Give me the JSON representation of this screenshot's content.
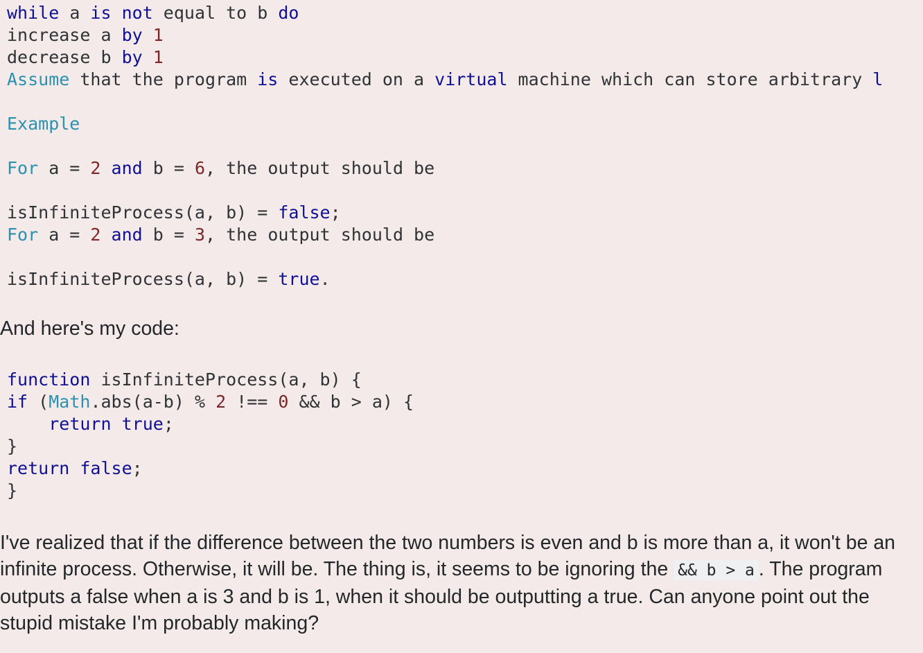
{
  "problem_block": {
    "lines": [
      [
        {
          "t": "while",
          "c": "kw"
        },
        {
          "t": " a "
        },
        {
          "t": "is",
          "c": "kw"
        },
        {
          "t": " "
        },
        {
          "t": "not",
          "c": "kw"
        },
        {
          "t": " equal to b "
        },
        {
          "t": "do",
          "c": "kw"
        }
      ],
      [
        {
          "t": "increase a "
        },
        {
          "t": "by",
          "c": "kw"
        },
        {
          "t": " "
        },
        {
          "t": "1",
          "c": "num"
        }
      ],
      [
        {
          "t": "decrease b "
        },
        {
          "t": "by",
          "c": "kw"
        },
        {
          "t": " "
        },
        {
          "t": "1",
          "c": "num"
        }
      ],
      [
        {
          "t": "Assume",
          "c": "tp"
        },
        {
          "t": " that the program "
        },
        {
          "t": "is",
          "c": "kw"
        },
        {
          "t": " executed on a "
        },
        {
          "t": "virtual",
          "c": "kw"
        },
        {
          "t": " machine which can store arbitrary "
        },
        {
          "t": "l",
          "c": "kw"
        }
      ],
      [
        {
          "t": ""
        }
      ],
      [
        {
          "t": "Example",
          "c": "tp"
        }
      ],
      [
        {
          "t": ""
        }
      ],
      [
        {
          "t": "For",
          "c": "tp"
        },
        {
          "t": " a = "
        },
        {
          "t": "2",
          "c": "num"
        },
        {
          "t": " "
        },
        {
          "t": "and",
          "c": "kw"
        },
        {
          "t": " b = "
        },
        {
          "t": "6",
          "c": "num"
        },
        {
          "t": ", the output should be"
        }
      ],
      [
        {
          "t": ""
        }
      ],
      [
        {
          "t": "isInfiniteProcess(a, b) = "
        },
        {
          "t": "false",
          "c": "kw"
        },
        {
          "t": ";"
        }
      ],
      [
        {
          "t": "For",
          "c": "tp"
        },
        {
          "t": " a = "
        },
        {
          "t": "2",
          "c": "num"
        },
        {
          "t": " "
        },
        {
          "t": "and",
          "c": "kw"
        },
        {
          "t": " b = "
        },
        {
          "t": "3",
          "c": "num"
        },
        {
          "t": ", the output should be"
        }
      ],
      [
        {
          "t": ""
        }
      ],
      [
        {
          "t": "isInfiniteProcess(a, b) = "
        },
        {
          "t": "true",
          "c": "kw"
        },
        {
          "t": "."
        }
      ]
    ]
  },
  "intro_text": "And here's my code:",
  "code_block": {
    "lines": [
      [
        {
          "t": "function",
          "c": "kw"
        },
        {
          "t": " isInfiniteProcess(a, b) {"
        }
      ],
      [
        {
          "t": "if",
          "c": "kw"
        },
        {
          "t": " ("
        },
        {
          "t": "Math",
          "c": "tp"
        },
        {
          "t": ".abs(a-b) % "
        },
        {
          "t": "2",
          "c": "num"
        },
        {
          "t": " !== "
        },
        {
          "t": "0",
          "c": "num"
        },
        {
          "t": " && b > a) {"
        }
      ],
      [
        {
          "t": "    "
        },
        {
          "t": "return",
          "c": "kw"
        },
        {
          "t": " "
        },
        {
          "t": "true",
          "c": "kw"
        },
        {
          "t": ";"
        }
      ],
      [
        {
          "t": "}"
        }
      ],
      [
        {
          "t": "return",
          "c": "kw"
        },
        {
          "t": " "
        },
        {
          "t": "false",
          "c": "kw"
        },
        {
          "t": ";"
        }
      ],
      [
        {
          "t": "}"
        }
      ]
    ]
  },
  "question": {
    "before_code": "I've realized that if the difference between the two numbers is even and b is more than a, it won't be an infinite process. Otherwise, it will be. The thing is, it seems to be ignoring the ",
    "inline_code": "&& b > a",
    "after_code": ". The program outputs a false when a is 3 and b is 1, when it should be outputting a true. Can anyone point out the stupid mistake I'm probably making?"
  }
}
